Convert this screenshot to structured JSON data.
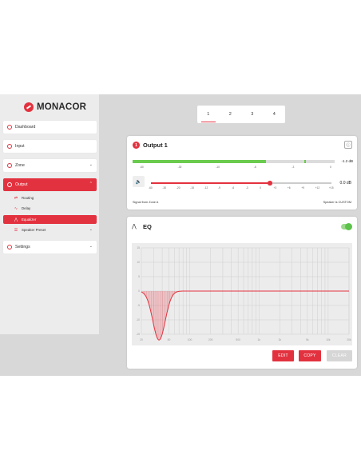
{
  "brand": {
    "name": "MONACOR"
  },
  "sidebar": {
    "items": [
      {
        "label": "Dashboard",
        "icon": "dashboard-icon"
      },
      {
        "label": "Input",
        "icon": "input-icon"
      },
      {
        "label": "Zone",
        "icon": "zone-icon"
      },
      {
        "label": "Output",
        "icon": "output-icon"
      },
      {
        "label": "Settings",
        "icon": "settings-icon"
      }
    ],
    "subitems": [
      {
        "label": "Routing",
        "icon": "routing-icon"
      },
      {
        "label": "Delay",
        "icon": "delay-icon"
      },
      {
        "label": "Equalizer",
        "icon": "equalizer-icon"
      },
      {
        "label": "Speaker Preset",
        "icon": "speaker-preset-icon"
      }
    ],
    "accent": "#e3323f"
  },
  "tabs": [
    "1",
    "2",
    "3",
    "4"
  ],
  "active_tab": "1",
  "output": {
    "number": "1",
    "title": "Output 1",
    "meter": {
      "scale": [
        "-60",
        "-30",
        "-10",
        "-6",
        "-3",
        "0"
      ],
      "level_fraction": 0.66,
      "peak_fraction": 0.85,
      "value": "-1.2",
      "unit": "dB"
    },
    "volume": {
      "scale": [
        "-60",
        "-30",
        "-20",
        "-15",
        "-12",
        "-9",
        "-6",
        "-3",
        "0",
        "+3",
        "+6",
        "+9",
        "+12",
        "+15"
      ],
      "fraction": 0.66,
      "value": "0.0",
      "unit": "dB"
    },
    "signal_text": "Signal from Zone A",
    "speaker_text": "Speaker is CUSTOM"
  },
  "eq": {
    "title": "EQ",
    "enabled": true,
    "y_ticks": [
      "15",
      "10",
      "5",
      "0",
      "-5",
      "-10",
      "-15"
    ],
    "x_ticks": [
      "20",
      "50",
      "100",
      "200",
      "500",
      "1k",
      "2k",
      "5k",
      "10k",
      "20k"
    ],
    "curve_color": "#e3323f"
  },
  "buttons": {
    "edit": "EDIT",
    "copy": "COPY",
    "clear": "CLEAR"
  }
}
